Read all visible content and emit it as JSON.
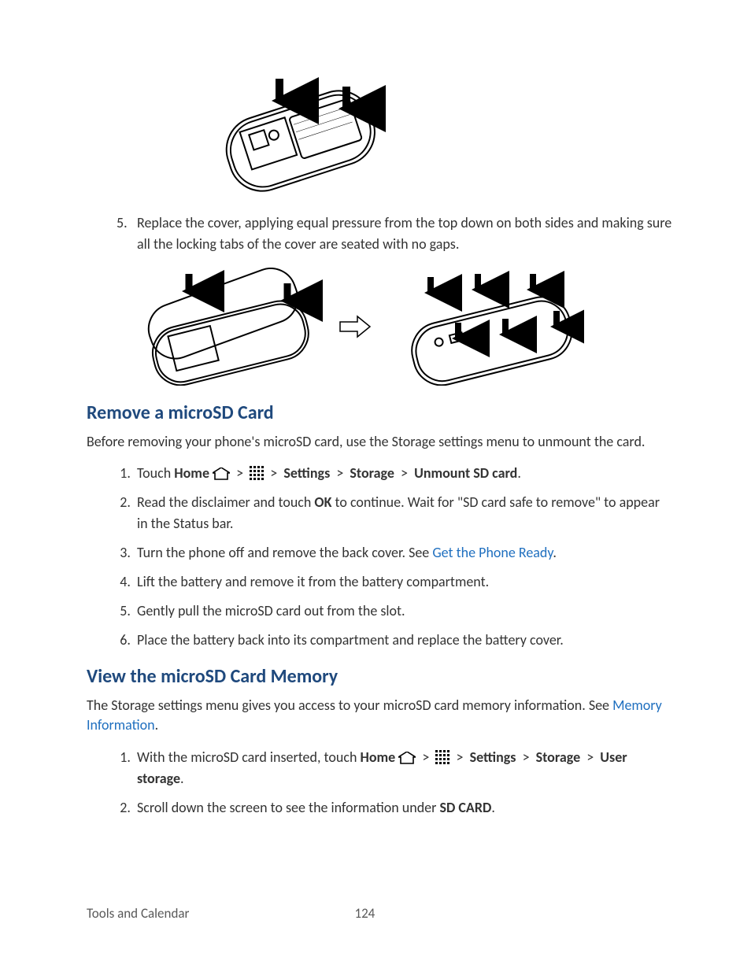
{
  "step5": "Replace the cover, applying equal pressure from the top down on both sides and making sure all the locking tabs of the cover are seated with no gaps.",
  "section1": {
    "heading": "Remove a microSD Card",
    "intro": "Before removing your phone's microSD card, use the Storage settings menu to unmount the card.",
    "steps": {
      "s1a": "Touch ",
      "home": "Home",
      "s1_settings": "Settings",
      "s1_storage": "Storage",
      "s1_unmount": "Unmount SD card",
      "s2a": "Read the disclaimer and touch ",
      "ok": "OK",
      "s2b": " to continue. Wait for \"SD card safe to remove\" to appear in the Status bar.",
      "s3a": "Turn the phone off and remove the back cover. See ",
      "s3link": "Get the Phone Ready",
      "s4": "Lift the battery and remove it from the battery compartment.",
      "s5": "Gently pull the microSD card out from the slot.",
      "s6": "Place the battery back into its compartment and replace the battery cover."
    }
  },
  "section2": {
    "heading": "View the microSD Card Memory",
    "intro_a": "The Storage settings menu gives you access to your microSD card memory information. See ",
    "intro_link": "Memory Information",
    "steps": {
      "s1a": "With the microSD card inserted, touch ",
      "home": "Home",
      "settings": "Settings",
      "storage": "Storage",
      "user_storage": "User storage",
      "s2a": "Scroll down the screen to see the information under ",
      "sd_card": "SD CARD"
    }
  },
  "footer": {
    "section": "Tools and Calendar",
    "page": "124"
  },
  "gt": ">"
}
